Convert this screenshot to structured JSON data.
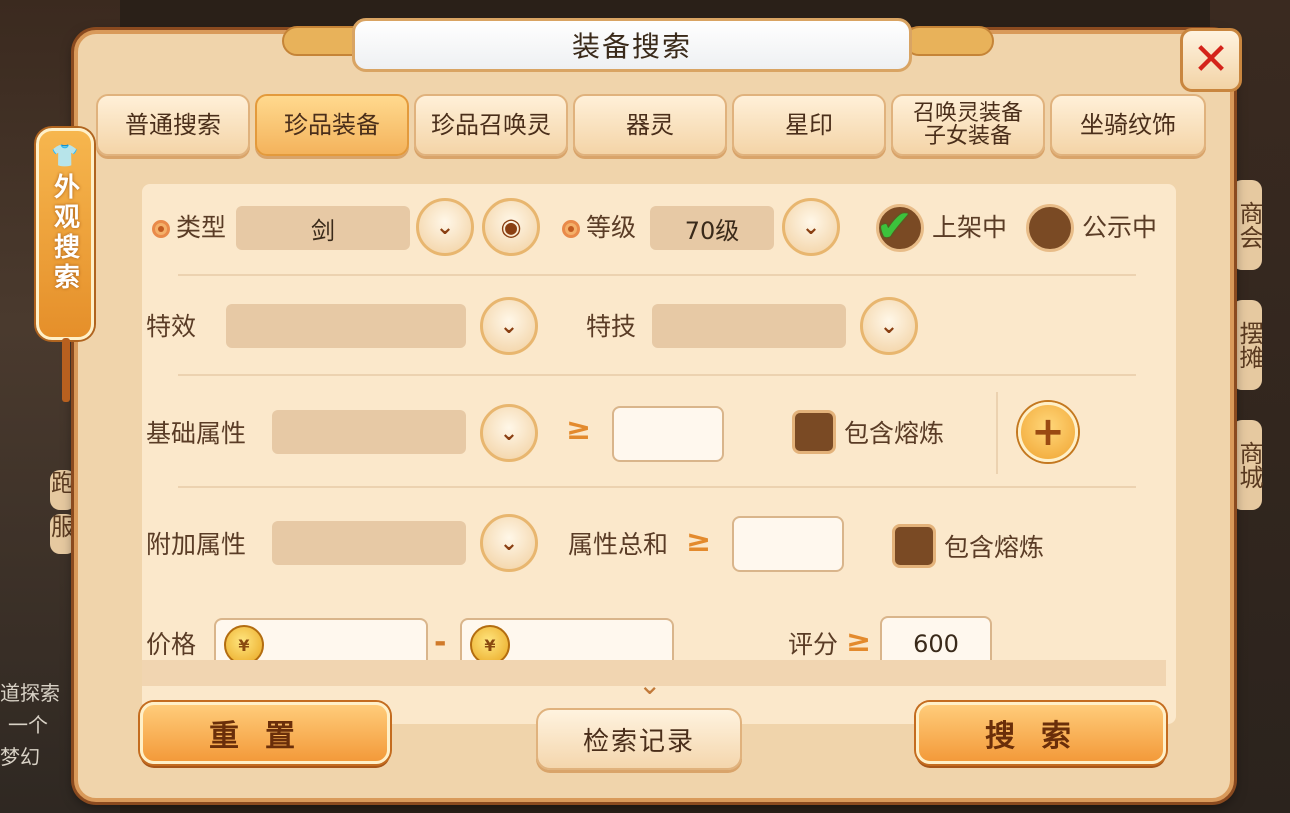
{
  "title": "装备搜索",
  "side_tag": "外观搜索",
  "background": {
    "peek_right": [
      "商会",
      "摆摊",
      "商城"
    ],
    "peek_left": [
      "跑",
      "服"
    ],
    "left_lines": [
      "道探索",
      "一个",
      "梦幻"
    ]
  },
  "tabs": [
    {
      "label": "普通搜索",
      "active": false
    },
    {
      "label": "珍品装备",
      "active": true
    },
    {
      "label": "珍品召唤灵",
      "active": false
    },
    {
      "label": "器灵",
      "active": false
    },
    {
      "label": "星印",
      "active": false
    },
    {
      "label": "召唤灵装备\n子女装备",
      "active": false
    },
    {
      "label": "坐骑纹饰",
      "active": false
    }
  ],
  "form": {
    "type_label": "类型",
    "type_value": "剑",
    "level_label": "等级",
    "level_value": "70级",
    "on_shelf_label": "上架中",
    "on_shelf_checked": true,
    "public_label": "公示中",
    "public_checked": false,
    "effect_label": "特效",
    "skill_label": "特技",
    "base_attr_label": "基础属性",
    "base_attr_ge": "≥",
    "base_include_label": "包含熔炼",
    "extra_attr_label": "附加属性",
    "attr_sum_label": "属性总和",
    "attr_sum_ge": "≥",
    "extra_include_label": "包含熔炼",
    "price_label": "价格",
    "price_dash": "-",
    "score_label": "评分",
    "score_ge": "≥",
    "score_value": "600"
  },
  "buttons": {
    "reset": "重置",
    "history": "检索记录",
    "search": "搜索"
  },
  "icons": {
    "dropdown": "chevron-down-icon",
    "eye": "eye-icon",
    "close": "close-icon",
    "plus": "plus-icon",
    "coin": "coin-icon",
    "check": "check-icon"
  },
  "colors": {
    "panel": "#f0d4ab",
    "accent": "#f39a3a",
    "close": "#d4231a",
    "check": "#3cc23c"
  }
}
